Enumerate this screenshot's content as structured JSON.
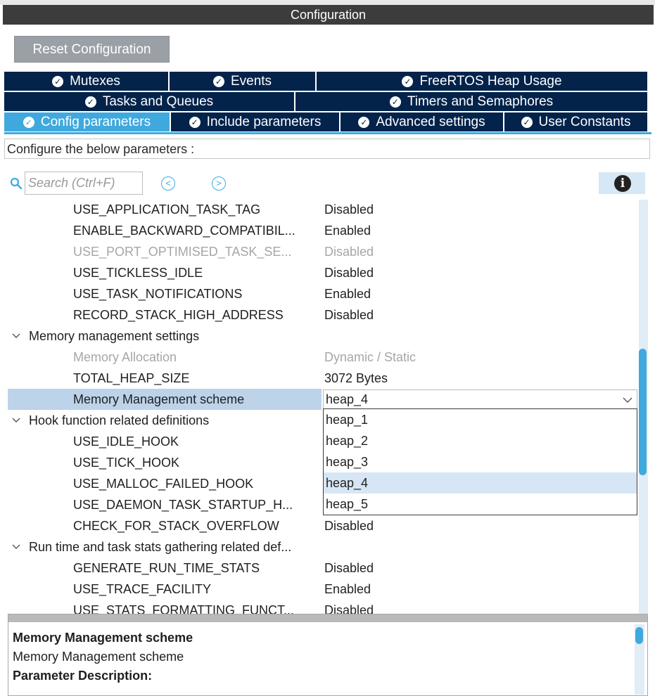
{
  "window": {
    "title": "Configuration"
  },
  "toolbar": {
    "reset_label": "Reset Configuration"
  },
  "tabs": {
    "row1": [
      {
        "label": "Mutexes"
      },
      {
        "label": "Events"
      },
      {
        "label": "FreeRTOS Heap Usage"
      }
    ],
    "row2": [
      {
        "label": "Tasks and Queues"
      },
      {
        "label": "Timers and Semaphores"
      }
    ],
    "row3": [
      {
        "label": "Config parameters",
        "active": true
      },
      {
        "label": "Include parameters"
      },
      {
        "label": "Advanced settings"
      },
      {
        "label": "User Constants"
      }
    ],
    "icon": "check-circle-icon"
  },
  "instructions": "Configure the below parameters :",
  "search": {
    "placeholder": "Search (Ctrl+F)"
  },
  "params": [
    {
      "name": "USE_APPLICATION_TASK_TAG",
      "value": "Disabled"
    },
    {
      "name": "ENABLE_BACKWARD_COMPATIBIL...",
      "value": "Enabled"
    },
    {
      "name": "USE_PORT_OPTIMISED_TASK_SE...",
      "value": "Disabled",
      "dim": true
    },
    {
      "name": "USE_TICKLESS_IDLE",
      "value": "Disabled"
    },
    {
      "name": "USE_TASK_NOTIFICATIONS",
      "value": "Enabled"
    },
    {
      "name": "RECORD_STACK_HIGH_ADDRESS",
      "value": "Disabled"
    },
    {
      "group": "Memory management settings"
    },
    {
      "name": "Memory Allocation",
      "value": "Dynamic / Static",
      "dim": true
    },
    {
      "name": "TOTAL_HEAP_SIZE",
      "value": "3072 Bytes"
    },
    {
      "name": "Memory Management scheme",
      "value": "heap_4",
      "selected": true
    },
    {
      "group": "Hook function related definitions"
    },
    {
      "name": "USE_IDLE_HOOK",
      "value": ""
    },
    {
      "name": "USE_TICK_HOOK",
      "value": ""
    },
    {
      "name": "USE_MALLOC_FAILED_HOOK",
      "value": ""
    },
    {
      "name": "USE_DAEMON_TASK_STARTUP_H...",
      "value": ""
    },
    {
      "name": "CHECK_FOR_STACK_OVERFLOW",
      "value": "Disabled"
    },
    {
      "group": "Run time and task stats gathering related def..."
    },
    {
      "name": "GENERATE_RUN_TIME_STATS",
      "value": "Disabled"
    },
    {
      "name": "USE_TRACE_FACILITY",
      "value": "Enabled"
    },
    {
      "name": "USE_STATS_FORMATTING_FUNCT...",
      "value": "Disabled"
    }
  ],
  "dropdown": {
    "selected": "heap_4",
    "options": [
      "heap_1",
      "heap_2",
      "heap_3",
      "heap_4",
      "heap_5"
    ]
  },
  "description": {
    "title": "Memory Management scheme",
    "subtitle": "Memory Management scheme",
    "section": "Parameter Description:"
  },
  "colors": {
    "tab_bg": "#03234b",
    "tab_active": "#3fa9de",
    "selection": "#bcd3ea",
    "dim_text": "#a6a6a6"
  }
}
